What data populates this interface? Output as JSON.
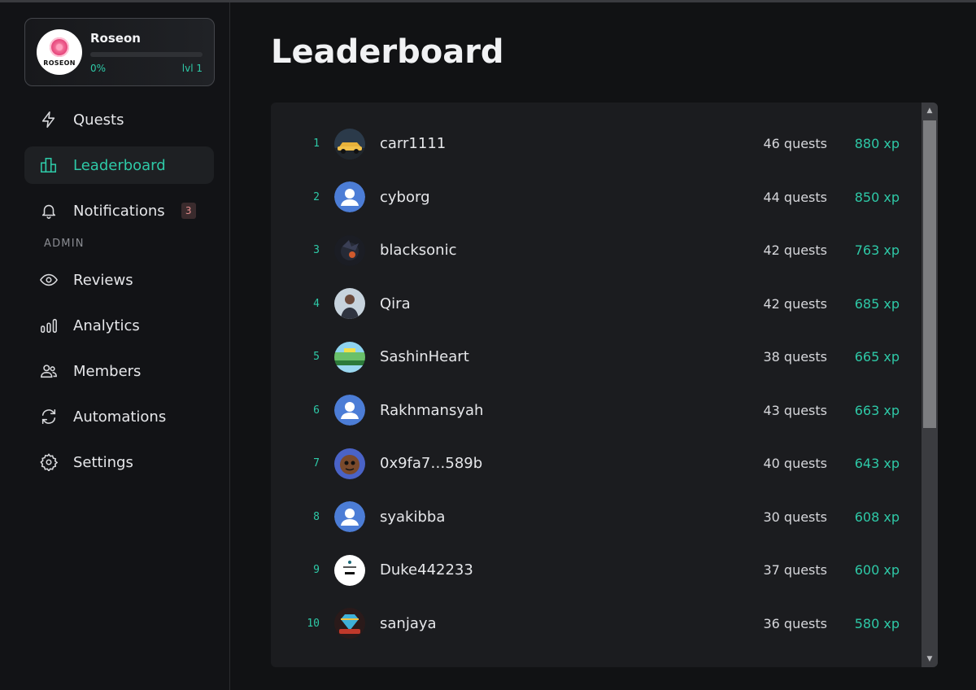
{
  "profile": {
    "name": "Roseon",
    "logo_text": "ROSEON",
    "progress_text": "0%",
    "progress_value": 0,
    "level_text": "lvl 1"
  },
  "nav": {
    "quests": "Quests",
    "leaderboard": "Leaderboard",
    "notifications": "Notifications",
    "notifications_badge": "3",
    "admin_label": "ADMIN",
    "reviews": "Reviews",
    "analytics": "Analytics",
    "members": "Members",
    "automations": "Automations",
    "settings": "Settings"
  },
  "page": {
    "title": "Leaderboard"
  },
  "leaderboard": [
    {
      "rank": "1",
      "name": "carr1111",
      "quests": "46 quests",
      "xp": "880 xp",
      "avatar": "car-avatar"
    },
    {
      "rank": "2",
      "name": "cyborg",
      "quests": "44 quests",
      "xp": "850 xp",
      "avatar": "default-user-icon"
    },
    {
      "rank": "3",
      "name": "blacksonic",
      "quests": "42 quests",
      "xp": "763 xp",
      "avatar": "sonic-avatar"
    },
    {
      "rank": "4",
      "name": "Qira",
      "quests": "42 quests",
      "xp": "685 xp",
      "avatar": "person-avatar"
    },
    {
      "rank": "5",
      "name": "SashinHeart",
      "quests": "38 quests",
      "xp": "665 xp",
      "avatar": "landscape-avatar"
    },
    {
      "rank": "6",
      "name": "Rakhmansyah",
      "quests": "43 quests",
      "xp": "663 xp",
      "avatar": "default-user-icon"
    },
    {
      "rank": "7",
      "name": "0x9fa7…589b",
      "quests": "40 quests",
      "xp": "643 xp",
      "avatar": "cartoon-avatar"
    },
    {
      "rank": "8",
      "name": "syakibba",
      "quests": "30 quests",
      "xp": "608 xp",
      "avatar": "default-user-icon"
    },
    {
      "rank": "9",
      "name": "Duke442233",
      "quests": "37 quests",
      "xp": "600 xp",
      "avatar": "white-avatar"
    },
    {
      "rank": "10",
      "name": "sanjaya",
      "quests": "36 quests",
      "xp": "580 xp",
      "avatar": "gem-avatar"
    }
  ]
}
